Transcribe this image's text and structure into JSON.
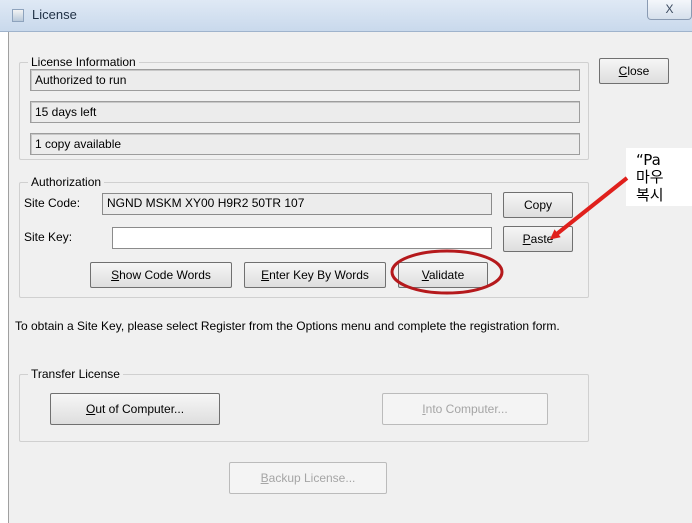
{
  "window": {
    "title": "License",
    "close_glyph": "X"
  },
  "license_info": {
    "legend": "License Information",
    "fields": [
      "Authorized to run",
      "15 days left",
      "1 copy available"
    ]
  },
  "close_button": {
    "underline": "C",
    "rest": "lose"
  },
  "authorization": {
    "legend": "Authorization",
    "site_code_label": "Site Code:",
    "site_code_value": "NGND MSKM XY00 H9R2 50TR 107",
    "site_key_label": "Site Key:",
    "site_key_value": "",
    "copy_label": "Copy",
    "paste_button": {
      "underline": "P",
      "rest": "aste"
    },
    "show_code_words": {
      "underline": "S",
      "rest": "how Code Words"
    },
    "enter_key_by_words": {
      "underline": "E",
      "rest": "nter Key By Words"
    },
    "validate": {
      "underline": "V",
      "rest": "alidate"
    }
  },
  "instructions": "To obtain a Site Key, please select Register from the Options menu and complete the registration form.",
  "transfer": {
    "legend": "Transfer License",
    "out_button": {
      "underline": "O",
      "rest": "ut of Computer..."
    },
    "into_button": {
      "underline": "I",
      "rest": "nto Computer..."
    }
  },
  "backup_button": {
    "underline": "B",
    "rest": "ackup License..."
  },
  "annotation": {
    "line1": "“Pa",
    "line2": "마우",
    "line3": "복시",
    "arrow_color": "#e0201c",
    "circle_color": "#b5191c"
  }
}
